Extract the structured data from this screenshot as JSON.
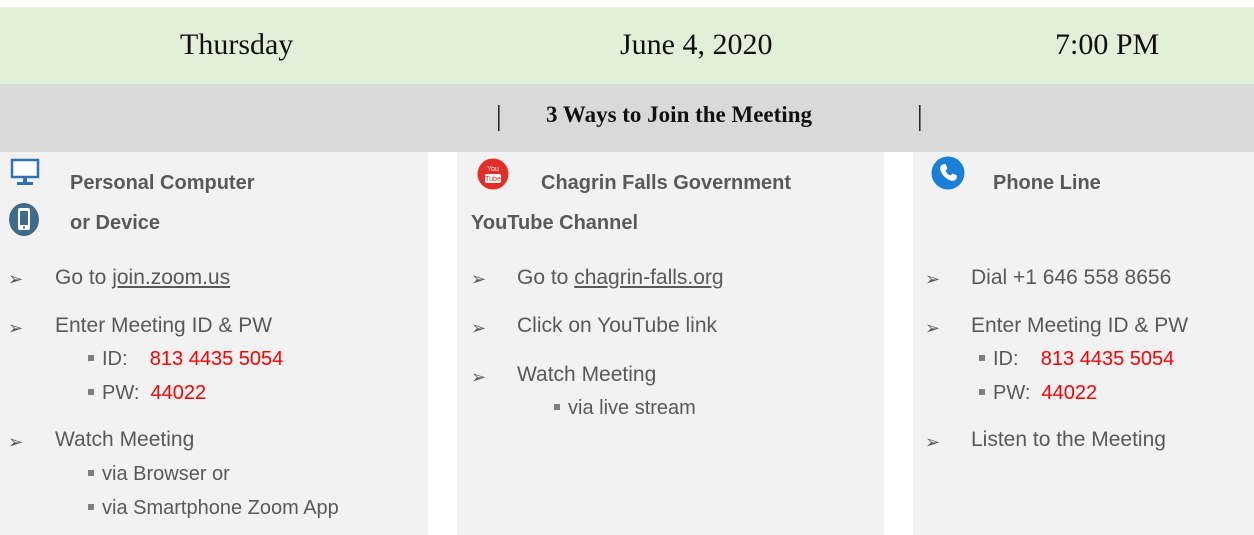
{
  "header": {
    "day": "Thursday",
    "date": "June 4, 2020",
    "time": "7:00 PM"
  },
  "title": {
    "separator": "|",
    "text": "3 Ways to Join the Meeting"
  },
  "bullet_glyph": "➢",
  "columns": {
    "computer": {
      "heading_line1": "Personal Computer",
      "heading_line2": "or Device",
      "go_to_prefix": "Go to ",
      "go_to_link": "join.zoom.us",
      "enter": "Enter Meeting ID & PW",
      "id_label": "ID:",
      "id_value": "813 4435 5054",
      "pw_label": "PW:",
      "pw_value": "44022",
      "watch": "Watch Meeting",
      "via1": "via Browser or",
      "via2": "via Smartphone Zoom App"
    },
    "youtube": {
      "heading_line1": "Chagrin Falls Government",
      "heading_line2": "YouTube Channel",
      "icon_text_top": "You",
      "icon_text_bottom": "Tube",
      "go_to_prefix": "Go to ",
      "go_to_link": "chagrin-falls.org",
      "click": "Click on YouTube link",
      "watch": "Watch Meeting",
      "via": "via live stream"
    },
    "phone": {
      "heading": "Phone Line",
      "dial": "Dial +1 646 558 8656",
      "enter": "Enter Meeting ID & PW",
      "id_label": "ID:",
      "id_value": "813 4435 5054",
      "pw_label": "PW:",
      "pw_value": "44022",
      "listen": "Listen to the Meeting"
    }
  },
  "colors": {
    "header_bg": "#e2efd9",
    "title_bg": "#d9d9d9",
    "column_bg": "#f2f2f2",
    "highlight": "#ff0000",
    "youtube_red": "#e52d27",
    "phone_blue": "#1a7fd8"
  }
}
